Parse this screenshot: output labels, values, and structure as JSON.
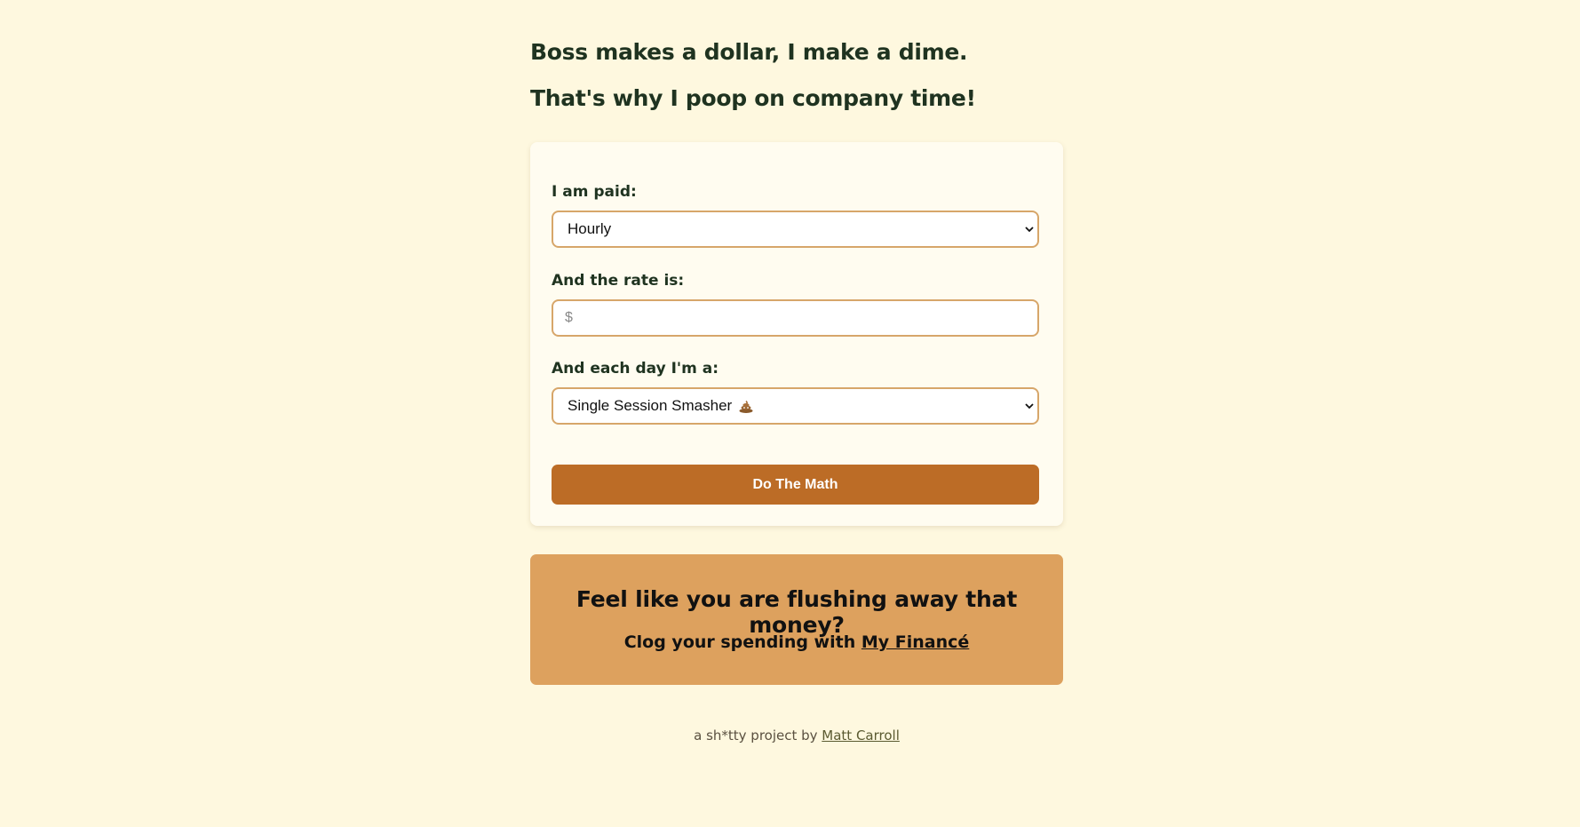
{
  "header": {
    "line1": "Boss makes a dollar, I make a dime.",
    "line2": "That's why I poop on company time!"
  },
  "form": {
    "pay_label": "I am paid:",
    "pay_value": "Hourly",
    "rate_label": "And the rate is:",
    "rate_placeholder": "$",
    "day_label": "And each day I'm a:",
    "day_value": "Single Session Smasher",
    "day_icon": "poop-emoji-icon",
    "submit_label": "Do The Math"
  },
  "promo": {
    "title": "Feel like you are flushing away that money?",
    "sub_prefix": "Clog your spending with ",
    "link_text": "My Financé"
  },
  "footer": {
    "prefix": "a sh*tty project by ",
    "author_link": "Matt Carroll"
  },
  "colors": {
    "background": "#fef8df",
    "card": "#fffcf0",
    "accent_border": "#d7a66a",
    "button": "#bc6c26",
    "promo": "#dda15e"
  }
}
